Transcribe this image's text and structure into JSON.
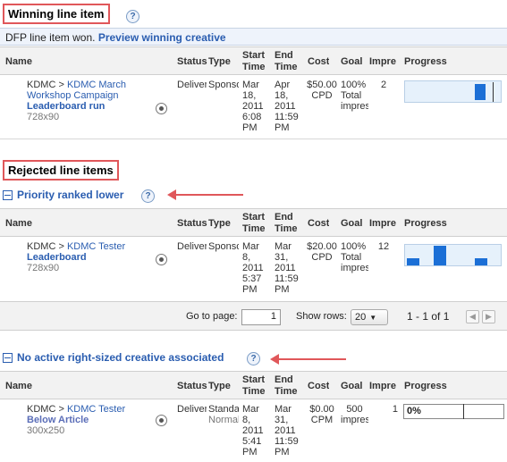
{
  "winning": {
    "title": "Winning line item",
    "info_text": "DFP line item won.",
    "info_link": "Preview winning creative"
  },
  "table_headers": {
    "name": "Name",
    "status": "Status",
    "type": "Type",
    "start": "Start Time",
    "end": "End Time",
    "cost": "Cost",
    "goal": "Goal",
    "impressions": "Impre",
    "progress": "Progress"
  },
  "winning_row": {
    "advertiser": "KDMC",
    "order": "KDMC March Workshop Campaign",
    "line_item": "Leaderboard run",
    "size": "728x90",
    "status": "Deliver",
    "type": "Sponso",
    "start": [
      "Mar",
      "18,",
      "2011",
      "6:08",
      "PM"
    ],
    "end": [
      "Apr",
      "18,",
      "2011",
      "11:59",
      "PM"
    ],
    "cost": "$50.00",
    "cost_unit": "CPD",
    "goal": [
      "100%",
      "Total",
      "impres"
    ],
    "impressions": "2"
  },
  "rejected": {
    "title": "Rejected line items",
    "group1_title": "Priority ranked lower",
    "group2_title": "No active right-sized creative associated"
  },
  "rejected_row1": {
    "advertiser": "KDMC",
    "order": "KDMC Tester",
    "line_item": "Leaderboard",
    "size": "728x90",
    "status": "Deliver",
    "type": "Sponso",
    "start": [
      "Mar",
      "8,",
      "2011",
      "5:37",
      "PM"
    ],
    "end": [
      "Mar",
      "31,",
      "2011",
      "11:59",
      "PM"
    ],
    "cost": "$20.00",
    "cost_unit": "CPD",
    "goal": [
      "100%",
      "Total",
      "impres"
    ],
    "impressions": "12"
  },
  "pager": {
    "goto_label": "Go to page:",
    "goto_value": "1",
    "rows_label": "Show rows:",
    "rows_value": "20",
    "range": "1 - 1 of 1"
  },
  "rejected_row2": {
    "advertiser": "KDMC",
    "order": "KDMC Tester",
    "line_item": "Below Article",
    "size": "300x250",
    "status": "Deliver",
    "type": [
      "Standa",
      "Normal"
    ],
    "start": [
      "Mar",
      "8,",
      "2011",
      "5:41",
      "PM"
    ],
    "end": [
      "Mar",
      "31,",
      "2011",
      "11:59",
      "PM"
    ],
    "cost": "$0.00",
    "cost_unit": "CPM",
    "goal": [
      "500",
      "impres"
    ],
    "impressions": "1",
    "progress_text": "0%"
  },
  "icons": {
    "help": "question-mark-icon",
    "target": "target-icon",
    "collapse": "minus-box-icon",
    "annotation": "red-arrow-icon"
  },
  "colors": {
    "accent_link": "#2a5db0",
    "highlight_border": "#e0575a",
    "progress_bar": "#1b6fd6"
  }
}
